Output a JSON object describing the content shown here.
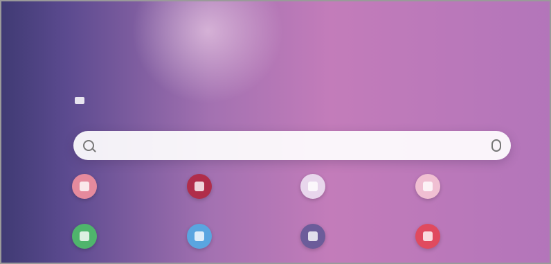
{
  "header": {
    "title": ""
  },
  "search": {
    "placeholder": "",
    "right_text": ""
  },
  "apps": [
    {
      "name": "app-1",
      "label": "",
      "color": "#e58a9d"
    },
    {
      "name": "app-2",
      "label": "",
      "color": "#b02d4a"
    },
    {
      "name": "app-3",
      "label": "",
      "color": "#e8d6ec"
    },
    {
      "name": "app-4",
      "label": "",
      "color": "#f0bfd2"
    },
    {
      "name": "app-5",
      "label": "",
      "color": "#4fb56c"
    },
    {
      "name": "app-6",
      "label": "",
      "color": "#5aa5e0"
    },
    {
      "name": "app-7",
      "label": "",
      "color": "#6c5c9a"
    },
    {
      "name": "app-8",
      "label": "",
      "color": "#e04a5f"
    }
  ]
}
